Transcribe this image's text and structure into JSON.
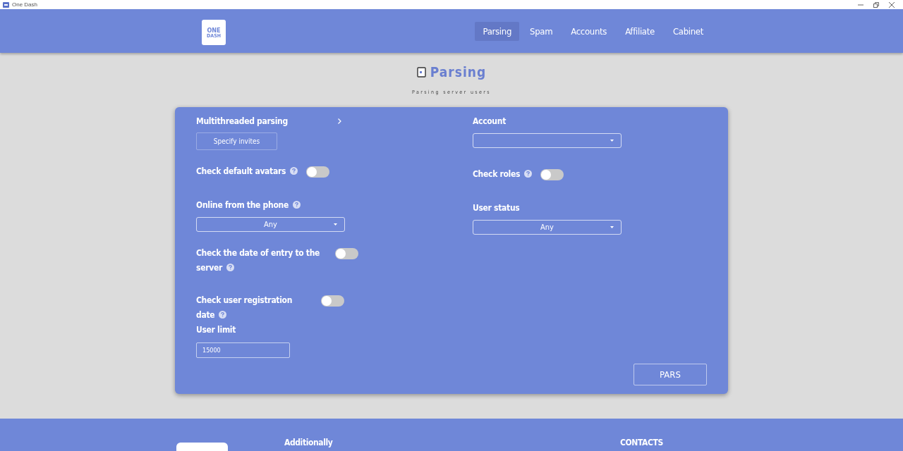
{
  "window": {
    "title": "One Dash"
  },
  "header": {
    "logo": {
      "line1": "ONE",
      "line2": "DASH"
    },
    "nav": [
      {
        "label": "Parsing",
        "selected": true
      },
      {
        "label": "Spam",
        "selected": false
      },
      {
        "label": "Accounts",
        "selected": false
      },
      {
        "label": "Affiliate",
        "selected": false
      },
      {
        "label": "Cabinet",
        "selected": false
      }
    ]
  },
  "heading": {
    "title": "Parsing",
    "subtitle": "Parsing server users"
  },
  "form": {
    "left": [
      {
        "kind": "expander",
        "label": "Multithreaded parsing",
        "button": "Specify invites"
      },
      {
        "kind": "toggle",
        "label": "Check default avatars",
        "help": true,
        "on": false
      },
      {
        "kind": "select",
        "label": "Online from the phone",
        "help": true,
        "value": "Any"
      },
      {
        "kind": "toggle",
        "label": "Check the date of entry to the server",
        "help": true,
        "on": false
      },
      {
        "kind": "toggle",
        "label": "Check user registration date",
        "help": true,
        "on": false
      },
      {
        "kind": "input",
        "label": "User limit",
        "value": "15000"
      }
    ],
    "right": [
      {
        "kind": "select",
        "label": "Account",
        "help": false
      },
      {
        "kind": "toggle",
        "label": "Check roles",
        "help": true,
        "on": false
      },
      {
        "kind": "select",
        "label": "User status",
        "help": false,
        "value": "Any"
      }
    ],
    "submit": "PARS"
  },
  "footer": {
    "columns": [
      "Additionally",
      "CONTACTS"
    ]
  }
}
